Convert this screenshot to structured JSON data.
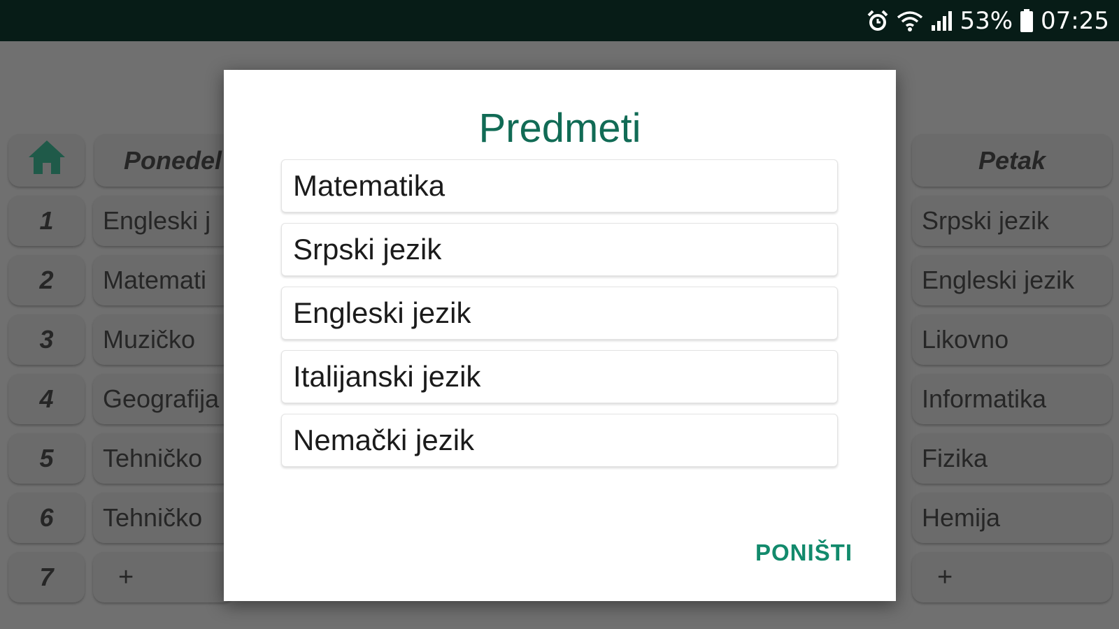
{
  "status_bar": {
    "battery_percent": "53%",
    "time": "07:25",
    "icons": [
      "alarm-icon",
      "wifi-icon",
      "signal-icon",
      "battery-icon"
    ]
  },
  "timetable": {
    "home_icon": "home-icon",
    "days": [
      "Ponedel",
      "Petak"
    ],
    "periods": [
      "1",
      "2",
      "3",
      "4",
      "5",
      "6",
      "7"
    ],
    "monday": [
      "Engleski j",
      "Matemati",
      "Muzičko",
      "Geografija",
      "Tehničko",
      "Tehničko",
      "+"
    ],
    "friday": [
      "Srpski jezik",
      "Engleski jezik",
      "Likovno",
      "Informatika",
      "Fizika",
      "Hemija",
      "+"
    ]
  },
  "dialog": {
    "title": "Predmeti",
    "subjects": [
      "Matematika",
      "Srpski jezik",
      "Engleski jezik",
      "Italijanski jezik",
      "Nemački jezik"
    ],
    "cancel_label": "PONIŠTI"
  },
  "colors": {
    "accent": "#116b55",
    "button": "#128a6c",
    "status_bar": "#071c17",
    "overlay_bg": "#707070"
  }
}
